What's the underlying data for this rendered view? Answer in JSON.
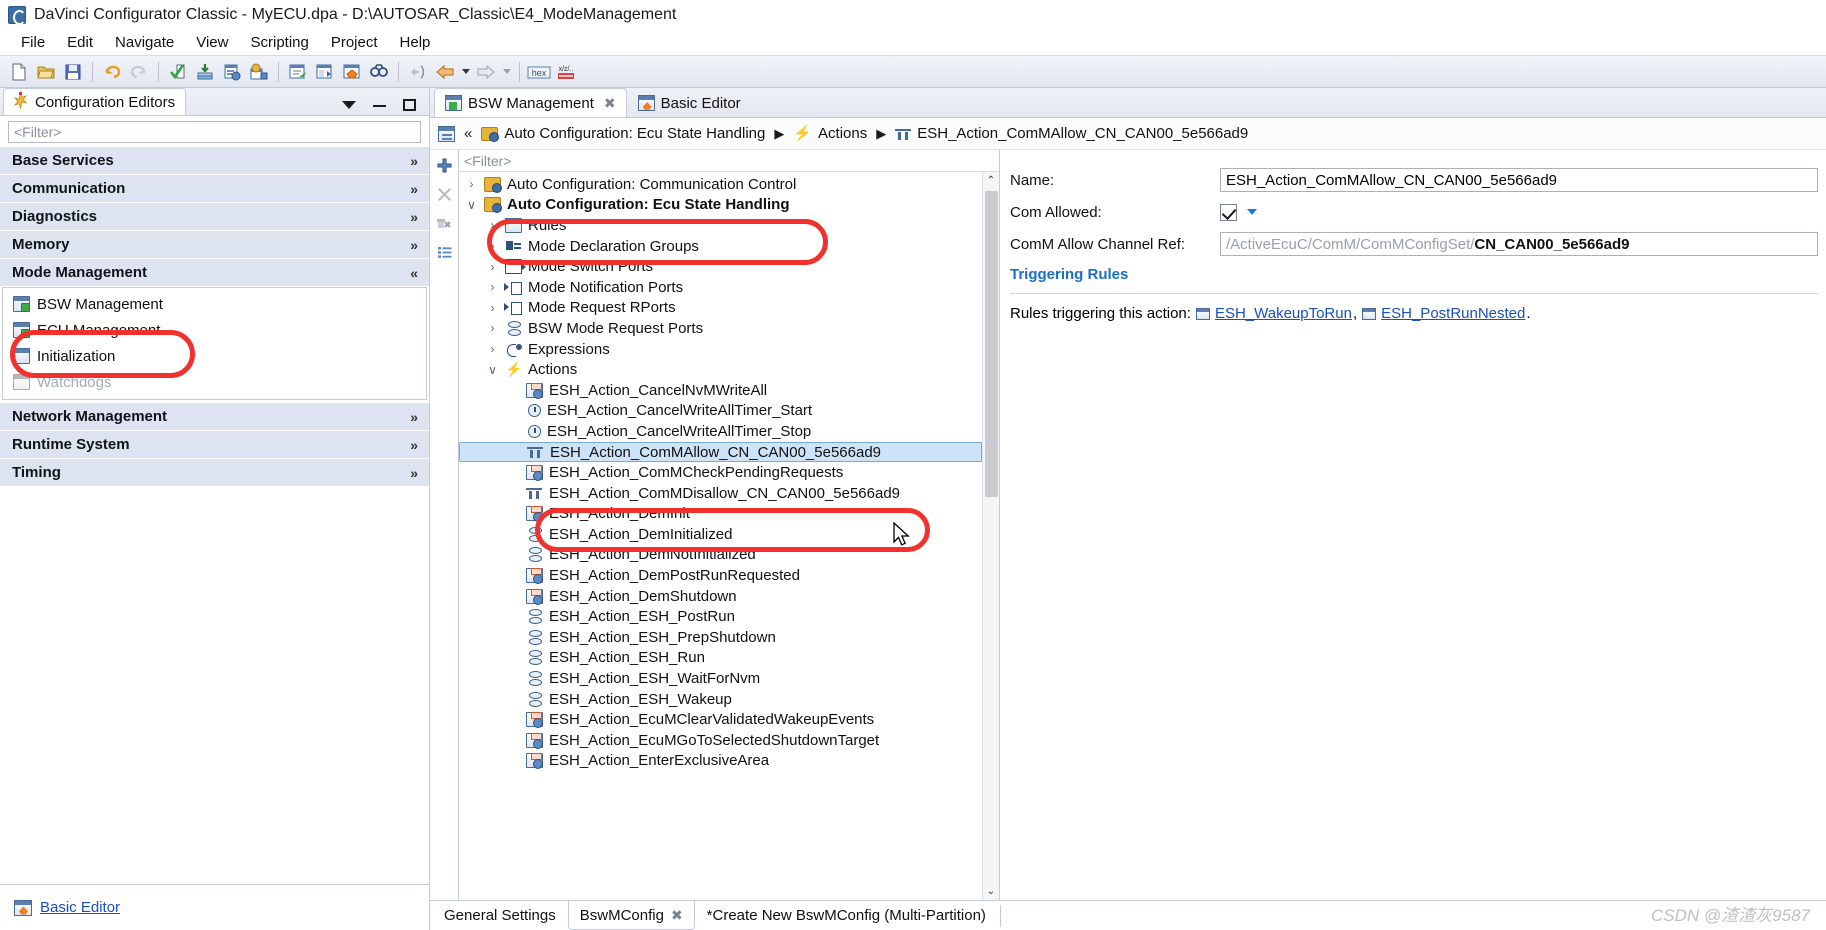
{
  "window": {
    "title": "DaVinci Configurator Classic - MyECU.dpa - D:\\AUTOSAR_Classic\\E4_ModeManagement",
    "app_icon": "davinci-icon"
  },
  "menubar": {
    "items": [
      "File",
      "Edit",
      "Navigate",
      "View",
      "Scripting",
      "Project",
      "Help"
    ]
  },
  "toolbar": {
    "groups": [
      [
        "new-icon",
        "open-icon",
        "save-icon"
      ],
      [
        "undo-icon",
        "redo-icon"
      ],
      [
        "validate-icon",
        "update-icon",
        "generate-icon",
        "settings-icon"
      ],
      [
        "open-editor-icon",
        "compare-icon",
        "basic-editor-icon",
        "find-icon"
      ],
      [
        "link-back-icon",
        "back-icon",
        "back-dropdown-icon",
        "forward-icon",
        "forward-dropdown-icon"
      ],
      [
        "hex-icon",
        "xyz-icon"
      ]
    ]
  },
  "left_panel": {
    "tab_label": "Configuration Editors",
    "tab_icon": "configuration-editors-icon",
    "header_actions": [
      "view-menu-icon",
      "minimize-icon",
      "maximize-icon"
    ],
    "filter_placeholder": "<Filter>",
    "sections": [
      {
        "label": "Base Services",
        "expanded": false,
        "chevron": "»"
      },
      {
        "label": "Communication",
        "expanded": false,
        "chevron": "»"
      },
      {
        "label": "Diagnostics",
        "expanded": false,
        "chevron": "»"
      },
      {
        "label": "Memory",
        "expanded": false,
        "chevron": "»"
      },
      {
        "label": "Mode Management",
        "expanded": true,
        "chevron": "«"
      },
      {
        "label": "Network Management",
        "expanded": false,
        "chevron": "»"
      },
      {
        "label": "Runtime System",
        "expanded": false,
        "chevron": "»"
      },
      {
        "label": "Timing",
        "expanded": false,
        "chevron": "»"
      }
    ],
    "mode_management_items": [
      {
        "label": "BSW Management",
        "icon": "bsw-management-icon",
        "disabled": false,
        "highlighted": true
      },
      {
        "label": "ECU Management",
        "icon": "ecu-management-icon",
        "disabled": false,
        "highlighted": false
      },
      {
        "label": "Initialization",
        "icon": "initialization-icon",
        "disabled": false,
        "highlighted": false
      },
      {
        "label": "Watchdogs",
        "icon": "watchdogs-icon",
        "disabled": true,
        "highlighted": false
      }
    ],
    "footer_link": "Basic Editor",
    "footer_icon": "basic-editor-icon"
  },
  "editor_tabs": [
    {
      "label": "BSW Management",
      "icon": "bsw-management-icon",
      "active": true,
      "closable": true
    },
    {
      "label": "Basic Editor",
      "icon": "basic-editor-icon",
      "active": false,
      "closable": false
    }
  ],
  "breadcrumb": {
    "leading_icon": "editor-icon",
    "collapse_icon": "«",
    "items": [
      {
        "label": "Auto Configuration: Ecu State Handling",
        "icon": "folder-config-icon"
      },
      {
        "label": "Actions",
        "icon": "actions-bolt-icon"
      },
      {
        "label": "ESH_Action_ComMAllow_CN_CAN00_5e566ad9",
        "icon": "comm-action-icon"
      }
    ],
    "separator": "▶"
  },
  "tree_panel": {
    "toolstrip": [
      "add-icon",
      "delete-icon",
      "delete-all-icon",
      "list-view-icon"
    ],
    "filter_placeholder": "<Filter>",
    "scrollbar": {
      "up_arrow": "⌃",
      "down_arrow": "⌄"
    },
    "nodes": [
      {
        "label": "Auto Configuration: Communication Control",
        "indent": 0,
        "twisty": "›",
        "icon": "folder-config-icon",
        "clipped": true
      },
      {
        "label": "Auto Configuration: Ecu State Handling",
        "indent": 0,
        "twisty": "∨",
        "icon": "folder-config-icon",
        "bold": true,
        "highlighted": true
      },
      {
        "label": "Rules",
        "indent": 1,
        "twisty": "›",
        "icon": "rules-icon"
      },
      {
        "label": "Mode Declaration Groups",
        "indent": 1,
        "twisty": "›",
        "icon": "mode-declaration-groups-icon"
      },
      {
        "label": "Mode Switch Ports",
        "indent": 1,
        "twisty": "›",
        "icon": "mode-switch-ports-icon"
      },
      {
        "label": "Mode Notification Ports",
        "indent": 1,
        "twisty": "›",
        "icon": "mode-notification-ports-icon"
      },
      {
        "label": "Mode Request RPorts",
        "indent": 1,
        "twisty": "›",
        "icon": "mode-request-rports-icon"
      },
      {
        "label": "BSW Mode Request Ports",
        "indent": 1,
        "twisty": "›",
        "icon": "bsw-mode-request-ports-icon"
      },
      {
        "label": "Expressions",
        "indent": 1,
        "twisty": "›",
        "icon": "expressions-icon"
      },
      {
        "label": "Actions",
        "indent": 1,
        "twisty": "∨",
        "icon": "actions-bolt-icon"
      },
      {
        "label": "ESH_Action_CancelNvMWriteAll",
        "indent": 2,
        "twisty": "",
        "icon": "action-gear-icon"
      },
      {
        "label": "ESH_Action_CancelWriteAllTimer_Start",
        "indent": 2,
        "twisty": "",
        "icon": "timer-icon"
      },
      {
        "label": "ESH_Action_CancelWriteAllTimer_Stop",
        "indent": 2,
        "twisty": "",
        "icon": "timer-icon"
      },
      {
        "label": "ESH_Action_ComMAllow_CN_CAN00_5e566ad9",
        "indent": 2,
        "twisty": "",
        "icon": "comm-action-icon",
        "selected": true
      },
      {
        "label": "ESH_Action_ComMCheckPendingRequests",
        "indent": 2,
        "twisty": "",
        "icon": "action-gear-icon"
      },
      {
        "label": "ESH_Action_ComMDisallow_CN_CAN00_5e566ad9",
        "indent": 2,
        "twisty": "",
        "icon": "comm-action-icon"
      },
      {
        "label": "ESH_Action_DemInit",
        "indent": 2,
        "twisty": "",
        "icon": "action-gear-icon"
      },
      {
        "label": "ESH_Action_DemInitialized",
        "indent": 2,
        "twisty": "",
        "icon": "bsw-mode-request-ports-icon"
      },
      {
        "label": "ESH_Action_DemNotInitialized",
        "indent": 2,
        "twisty": "",
        "icon": "bsw-mode-request-ports-icon"
      },
      {
        "label": "ESH_Action_DemPostRunRequested",
        "indent": 2,
        "twisty": "",
        "icon": "action-gear-icon"
      },
      {
        "label": "ESH_Action_DemShutdown",
        "indent": 2,
        "twisty": "",
        "icon": "action-gear-icon"
      },
      {
        "label": "ESH_Action_ESH_PostRun",
        "indent": 2,
        "twisty": "",
        "icon": "bsw-mode-request-ports-icon"
      },
      {
        "label": "ESH_Action_ESH_PrepShutdown",
        "indent": 2,
        "twisty": "",
        "icon": "bsw-mode-request-ports-icon"
      },
      {
        "label": "ESH_Action_ESH_Run",
        "indent": 2,
        "twisty": "",
        "icon": "bsw-mode-request-ports-icon"
      },
      {
        "label": "ESH_Action_ESH_WaitForNvm",
        "indent": 2,
        "twisty": "",
        "icon": "bsw-mode-request-ports-icon"
      },
      {
        "label": "ESH_Action_ESH_Wakeup",
        "indent": 2,
        "twisty": "",
        "icon": "bsw-mode-request-ports-icon"
      },
      {
        "label": "ESH_Action_EcuMClearValidatedWakeupEvents",
        "indent": 2,
        "twisty": "",
        "icon": "action-gear-icon"
      },
      {
        "label": "ESH_Action_EcuMGoToSelectedShutdownTarget",
        "indent": 2,
        "twisty": "",
        "icon": "action-gear-icon"
      },
      {
        "label": "ESH_Action_EnterExclusiveArea",
        "indent": 2,
        "twisty": "",
        "icon": "action-gear-icon"
      }
    ]
  },
  "properties": {
    "name_label": "Name:",
    "name_value": "ESH_Action_ComMAllow_CN_CAN00_5e566ad9",
    "com_allowed_label": "Com Allowed:",
    "com_allowed_checked": true,
    "com_allowed_dropdown_icon": "caret-down-icon",
    "channel_ref_label": "ComM Allow Channel Ref:",
    "channel_ref_prefix": "/ActiveEcuC/ComM/ComMConfigSet/",
    "channel_ref_value": "CN_CAN00_5e566ad9",
    "triggering_rules_title": "Triggering Rules",
    "rules_line_prefix": "Rules triggering this action:",
    "rules_links": [
      {
        "label": "ESH_WakeupToRun",
        "icon": "rule-icon"
      },
      {
        "label": "ESH_PostRunNested",
        "icon": "rule-icon"
      }
    ],
    "rules_separator": ",",
    "rules_terminator": "."
  },
  "bottom_tabs": [
    {
      "label": "General Settings",
      "active": false,
      "closable": false
    },
    {
      "label": "BswMConfig",
      "active": true,
      "closable": true
    },
    {
      "label": "*Create New BswMConfig (Multi-Partition)",
      "active": false,
      "closable": false
    }
  ],
  "watermark": "CSDN @渣渣灰9587",
  "colors": {
    "accent": "#1a6fc4",
    "link": "#1a4fbd",
    "annotation": "#f0312d",
    "selection": "#cde3f7",
    "section_header": "#dde3f0"
  }
}
